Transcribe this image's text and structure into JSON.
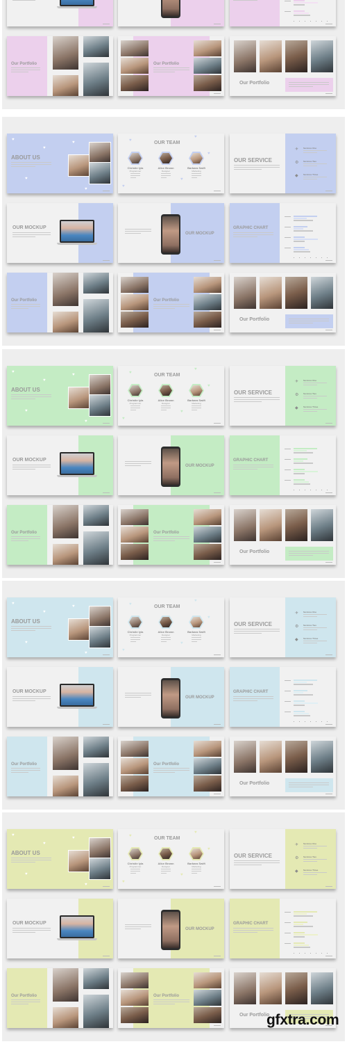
{
  "page": {
    "watermark": "gfxtra.com"
  },
  "slide_text": {
    "about": "ABOUT US",
    "team": "OUR TEAM",
    "service": "OUR SERVICE",
    "mockup": "OUR MOCKUP",
    "chart": "GRAPHIC CHART",
    "portfolio": "Our Portfolio"
  },
  "team_members": [
    {
      "name": "Christie Iyla",
      "role": "Programmer"
    },
    {
      "name": "Alice Brown",
      "role": "Designer"
    },
    {
      "name": "Barbara Swift",
      "role": "Marketing"
    }
  ],
  "services": [
    {
      "label": "Services One",
      "icon": "airplane-icon"
    },
    {
      "label": "Services Two",
      "icon": "gear-icon"
    },
    {
      "label": "Services Three",
      "icon": "diamond-icon"
    }
  ],
  "chart_data": {
    "type": "bar",
    "orientation": "horizontal",
    "title": "GRAPHIC CHART",
    "categories": [
      "Category 1",
      "Category 2",
      "Category 3",
      "Category 4"
    ],
    "series": [
      {
        "name": "Series 1",
        "values": [
          4.3,
          2.5,
          2.0,
          2.0
        ]
      },
      {
        "name": "Series 2",
        "values": [
          2.4,
          1.8,
          4.4,
          2.8
        ]
      },
      {
        "name": "Series 3",
        "values": [
          3.5,
          3.5,
          2.0,
          3.0
        ]
      }
    ],
    "xlim": [
      0,
      6
    ],
    "legend": "bottom"
  },
  "themes": [
    {
      "name": "pink",
      "accent": "#ecd0ec",
      "light": "#f3e0f3",
      "partial": true
    },
    {
      "name": "blue",
      "accent": "#c3cff0",
      "light": "#d6def5",
      "partial": false
    },
    {
      "name": "green",
      "accent": "#c4ecc4",
      "light": "#d8f3d8",
      "partial": false
    },
    {
      "name": "cyan",
      "accent": "#cfe6ee",
      "light": "#e0eff4",
      "partial": false
    },
    {
      "name": "yellow",
      "accent": "#e4e9b3",
      "light": "#edf1cc",
      "partial": false
    }
  ]
}
